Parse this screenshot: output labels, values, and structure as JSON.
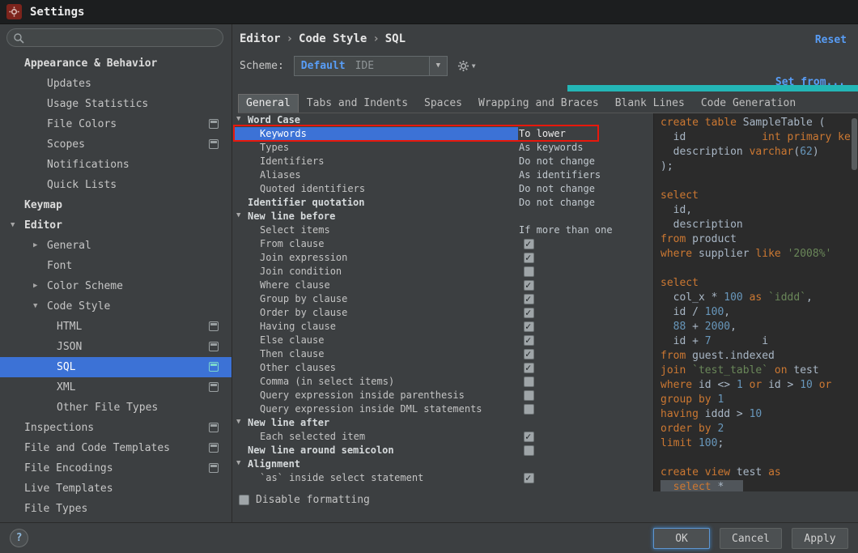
{
  "window": {
    "title": "Settings"
  },
  "colors": {
    "selection_blue": "#3C72D6",
    "link_blue": "#589DF6",
    "annotation_red": "#E8180C",
    "teal_strip": "#23B6B6",
    "code_keyword": "#CC7832",
    "code_number": "#6897BB",
    "code_string": "#6A8759",
    "code_plain": "#A9B7C6",
    "editor_background": "#2B2B2B"
  },
  "sidebar": {
    "search_placeholder": "",
    "items": [
      {
        "label": "Appearance & Behavior",
        "level": 0,
        "bold": true
      },
      {
        "label": "Updates",
        "level": 1
      },
      {
        "label": "Usage Statistics",
        "level": 1
      },
      {
        "label": "File Colors",
        "level": 1,
        "badge": true
      },
      {
        "label": "Scopes",
        "level": 1,
        "badge": true
      },
      {
        "label": "Notifications",
        "level": 1
      },
      {
        "label": "Quick Lists",
        "level": 1
      },
      {
        "label": "Keymap",
        "level": 0,
        "bold": true
      },
      {
        "label": "Editor",
        "level": 0,
        "bold": true,
        "arrow": "down"
      },
      {
        "label": "General",
        "level": 1,
        "arrow": "right"
      },
      {
        "label": "Font",
        "level": 1
      },
      {
        "label": "Color Scheme",
        "level": 1,
        "arrow": "right"
      },
      {
        "label": "Code Style",
        "level": 1,
        "arrow": "down"
      },
      {
        "label": "HTML",
        "level": 2,
        "badge": true
      },
      {
        "label": "JSON",
        "level": 2,
        "badge": true
      },
      {
        "label": "SQL",
        "level": 2,
        "badge": true,
        "selected": true
      },
      {
        "label": "XML",
        "level": 2,
        "badge": true
      },
      {
        "label": "Other File Types",
        "level": 2
      },
      {
        "label": "Inspections",
        "level": 0,
        "badge": true
      },
      {
        "label": "File and Code Templates",
        "level": 0,
        "badge": true
      },
      {
        "label": "File Encodings",
        "level": 0,
        "badge": true
      },
      {
        "label": "Live Templates",
        "level": 0
      },
      {
        "label": "File Types",
        "level": 0
      }
    ]
  },
  "header": {
    "breadcrumb": [
      "Editor",
      "Code Style",
      "SQL"
    ],
    "reset_label": "Reset",
    "scheme_label": "Scheme:",
    "scheme_value_primary": "Default",
    "scheme_value_secondary": "IDE",
    "set_from_label": "Set from..."
  },
  "tabs": [
    {
      "label": "General",
      "selected": true
    },
    {
      "label": "Tabs and Indents"
    },
    {
      "label": "Spaces"
    },
    {
      "label": "Wrapping and Braces"
    },
    {
      "label": "Blank Lines"
    },
    {
      "label": "Code Generation"
    }
  ],
  "tree": {
    "rows": [
      {
        "type": "group",
        "label": "Word Case",
        "bold": true,
        "indent": 0,
        "arrow": "down"
      },
      {
        "type": "value",
        "label": "Keywords",
        "value": "To lower",
        "indent": 1,
        "selected": true,
        "annotated": true
      },
      {
        "type": "value",
        "label": "Types",
        "value": "As keywords",
        "indent": 1
      },
      {
        "type": "value",
        "label": "Identifiers",
        "value": "Do not change",
        "indent": 1
      },
      {
        "type": "value",
        "label": "Aliases",
        "value": "As identifiers",
        "indent": 1
      },
      {
        "type": "value",
        "label": "Quoted identifiers",
        "value": "Do not change",
        "indent": 1
      },
      {
        "type": "value",
        "label": "Identifier quotation",
        "value": "Do not change",
        "indent": 0,
        "bold": true
      },
      {
        "type": "group",
        "label": "New line before",
        "bold": true,
        "indent": 0,
        "arrow": "down"
      },
      {
        "type": "value",
        "label": "Select items",
        "value": "If more than one",
        "indent": 1
      },
      {
        "type": "check",
        "label": "From clause",
        "checked": true,
        "indent": 1
      },
      {
        "type": "check",
        "label": "Join expression",
        "checked": true,
        "indent": 1
      },
      {
        "type": "check",
        "label": "Join condition",
        "checked": false,
        "indent": 1
      },
      {
        "type": "check",
        "label": "Where clause",
        "checked": true,
        "indent": 1
      },
      {
        "type": "check",
        "label": "Group by clause",
        "checked": true,
        "indent": 1
      },
      {
        "type": "check",
        "label": "Order by clause",
        "checked": true,
        "indent": 1
      },
      {
        "type": "check",
        "label": "Having clause",
        "checked": true,
        "indent": 1
      },
      {
        "type": "check",
        "label": "Else clause",
        "checked": true,
        "indent": 1
      },
      {
        "type": "check",
        "label": "Then clause",
        "checked": true,
        "indent": 1
      },
      {
        "type": "check",
        "label": "Other clauses",
        "checked": true,
        "indent": 1
      },
      {
        "type": "check",
        "label": "Comma (in select items)",
        "checked": false,
        "indent": 1
      },
      {
        "type": "check",
        "label": "Query expression inside parenthesis",
        "checked": false,
        "indent": 1
      },
      {
        "type": "check",
        "label": "Query expression inside DML statements",
        "checked": false,
        "indent": 1
      },
      {
        "type": "group",
        "label": "New line after",
        "bold": true,
        "indent": 0,
        "arrow": "down"
      },
      {
        "type": "check",
        "label": "Each selected item",
        "checked": true,
        "indent": 1
      },
      {
        "type": "check",
        "label": "New line around semicolon",
        "checked": false,
        "indent": 0,
        "bold": true
      },
      {
        "type": "group",
        "label": "Alignment",
        "bold": true,
        "indent": 0,
        "arrow": "down"
      },
      {
        "type": "check",
        "label": "`as` inside select statement",
        "checked": true,
        "indent": 1
      }
    ],
    "disable_formatting": {
      "label": "Disable formatting",
      "checked": false
    }
  },
  "preview": {
    "lines": [
      {
        "tokens": [
          [
            "k",
            "create table"
          ],
          [
            "p",
            " SampleTable ("
          ]
        ]
      },
      {
        "tokens": [
          [
            "p",
            "  id            "
          ],
          [
            "k",
            "int primary ke"
          ]
        ]
      },
      {
        "tokens": [
          [
            "p",
            "  description "
          ],
          [
            "k",
            "varchar"
          ],
          [
            "p",
            "("
          ],
          [
            "n",
            "62"
          ],
          [
            "p",
            ")"
          ]
        ]
      },
      {
        "tokens": [
          [
            "p",
            ");"
          ]
        ]
      },
      {
        "tokens": []
      },
      {
        "tokens": [
          [
            "k",
            "select"
          ]
        ]
      },
      {
        "tokens": [
          [
            "p",
            "  id,"
          ]
        ]
      },
      {
        "tokens": [
          [
            "p",
            "  description"
          ]
        ]
      },
      {
        "tokens": [
          [
            "k",
            "from"
          ],
          [
            "p",
            " product"
          ]
        ]
      },
      {
        "tokens": [
          [
            "k",
            "where"
          ],
          [
            "p",
            " supplier "
          ],
          [
            "k",
            "like"
          ],
          [
            "p",
            " "
          ],
          [
            "s",
            "'2008%'"
          ]
        ]
      },
      {
        "tokens": []
      },
      {
        "tokens": [
          [
            "k",
            "select"
          ]
        ]
      },
      {
        "tokens": [
          [
            "p",
            "  col_x * "
          ],
          [
            "n",
            "100"
          ],
          [
            "p",
            " "
          ],
          [
            "k",
            "as"
          ],
          [
            "p",
            " "
          ],
          [
            "s",
            "`iddd`"
          ],
          [
            "p",
            ","
          ]
        ]
      },
      {
        "tokens": [
          [
            "p",
            "  id / "
          ],
          [
            "n",
            "100"
          ],
          [
            "p",
            ","
          ]
        ]
      },
      {
        "tokens": [
          [
            "p",
            "  "
          ],
          [
            "n",
            "88"
          ],
          [
            "p",
            " + "
          ],
          [
            "n",
            "2000"
          ],
          [
            "p",
            ","
          ]
        ]
      },
      {
        "tokens": [
          [
            "p",
            "  id + "
          ],
          [
            "n",
            "7"
          ],
          [
            "p",
            "        i"
          ]
        ]
      },
      {
        "tokens": [
          [
            "k",
            "from"
          ],
          [
            "p",
            " guest.indexed"
          ]
        ]
      },
      {
        "tokens": [
          [
            "k",
            "join"
          ],
          [
            "p",
            " "
          ],
          [
            "s",
            "`test_table`"
          ],
          [
            "p",
            " "
          ],
          [
            "k",
            "on"
          ],
          [
            "p",
            " test"
          ]
        ]
      },
      {
        "tokens": [
          [
            "k",
            "where"
          ],
          [
            "p",
            " id <> "
          ],
          [
            "n",
            "1"
          ],
          [
            "p",
            " "
          ],
          [
            "k",
            "or"
          ],
          [
            "p",
            " id > "
          ],
          [
            "n",
            "10"
          ],
          [
            "p",
            " "
          ],
          [
            "k",
            "or"
          ]
        ]
      },
      {
        "tokens": [
          [
            "k",
            "group by"
          ],
          [
            "p",
            " "
          ],
          [
            "n",
            "1"
          ]
        ]
      },
      {
        "tokens": [
          [
            "k",
            "having"
          ],
          [
            "p",
            " iddd > "
          ],
          [
            "n",
            "10"
          ]
        ]
      },
      {
        "tokens": [
          [
            "k",
            "order by"
          ],
          [
            "p",
            " "
          ],
          [
            "n",
            "2"
          ]
        ]
      },
      {
        "tokens": [
          [
            "k",
            "limit"
          ],
          [
            "p",
            " "
          ],
          [
            "n",
            "100"
          ],
          [
            "p",
            ";"
          ]
        ]
      },
      {
        "tokens": []
      },
      {
        "tokens": [
          [
            "k",
            "create view"
          ],
          [
            "p",
            " test "
          ],
          [
            "k",
            "as"
          ]
        ]
      },
      {
        "hl": true,
        "tokens": [
          [
            "p",
            "  "
          ],
          [
            "k",
            "select"
          ],
          [
            "p",
            " *"
          ]
        ]
      }
    ]
  },
  "footer": {
    "help_label": "?",
    "ok_label": "OK",
    "cancel_label": "Cancel",
    "apply_label": "Apply"
  }
}
